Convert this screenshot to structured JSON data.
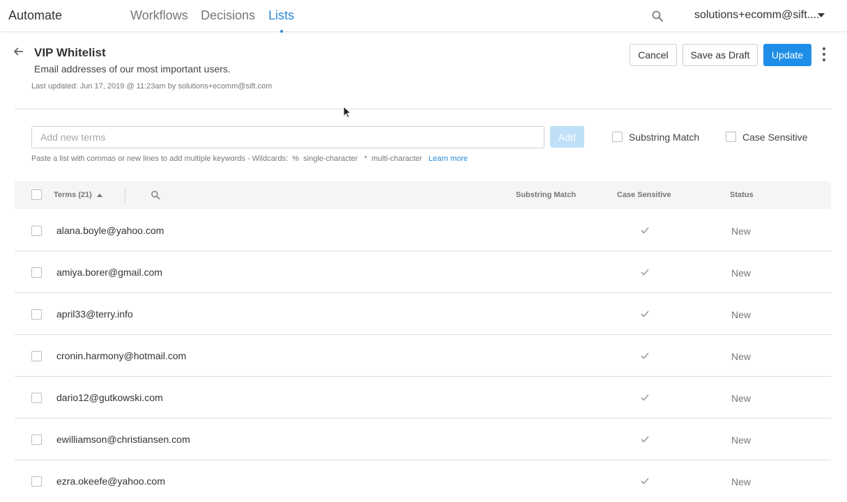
{
  "nav": {
    "brand": "Automate",
    "links": [
      "Workflows",
      "Decisions",
      "Lists"
    ],
    "active_link": "Lists",
    "account": "solutions+ecomm@sift...."
  },
  "header": {
    "title": "VIP Whitelist",
    "subtitle": "Email addresses of our most important users.",
    "updated": "Last updated: Jun 17, 2019 @ 11:23am by  solutions+ecomm@sift.com",
    "cancel_label": "Cancel",
    "draft_label": "Save as Draft",
    "update_label": "Update"
  },
  "add_terms": {
    "placeholder": "Add new terms",
    "add_label": "Add",
    "substring_label": "Substring Match",
    "case_label": "Case Sensitive",
    "hint_text": "Paste a list with commas or new lines to add multiple keywords - Wildcards:  %  single-character   *  multi-character",
    "learn_more": "Learn more"
  },
  "table": {
    "columns": {
      "terms": "Terms (21)",
      "substring": "Substring Match",
      "case": "Case Sensitive",
      "status": "Status"
    },
    "rows": [
      {
        "term": "alana.boyle@yahoo.com",
        "case_sensitive": true,
        "status": "New"
      },
      {
        "term": "amiya.borer@gmail.com",
        "case_sensitive": true,
        "status": "New"
      },
      {
        "term": "april33@terry.info",
        "case_sensitive": true,
        "status": "New"
      },
      {
        "term": "cronin.harmony@hotmail.com",
        "case_sensitive": true,
        "status": "New"
      },
      {
        "term": "dario12@gutkowski.com",
        "case_sensitive": true,
        "status": "New"
      },
      {
        "term": "ewilliamson@christiansen.com",
        "case_sensitive": true,
        "status": "New"
      },
      {
        "term": "ezra.okeefe@yahoo.com",
        "case_sensitive": true,
        "status": "New"
      }
    ]
  },
  "colors": {
    "accent": "#2b8ad8",
    "primary_button": "#1e8ee8",
    "add_button_disabled": "#bfe0f8",
    "header_bg": "#f4f5f6"
  },
  "icons": [
    "back-arrow-icon",
    "search-icon",
    "chevron-down-icon",
    "kebab-menu-icon",
    "sort-up-icon",
    "check-icon",
    "cursor-icon"
  ]
}
